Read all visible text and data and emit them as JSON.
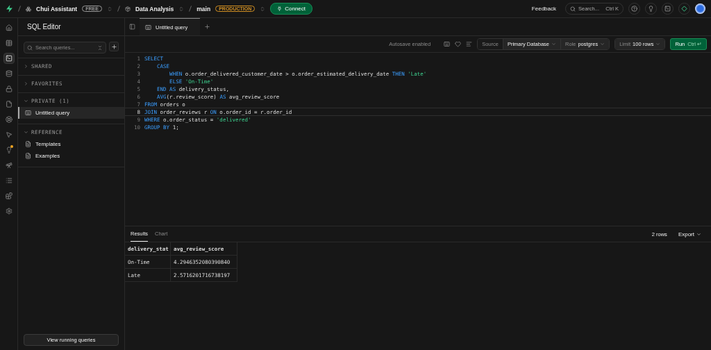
{
  "topbar": {
    "org": "Chui Assistant",
    "org_badge": "FREE",
    "project": "Data Analysis",
    "branch": "main",
    "branch_badge": "PRODUCTION",
    "connect": "Connect",
    "feedback": "Feedback",
    "search": {
      "placeholder": "Search...",
      "shortcut": "Ctrl K"
    }
  },
  "rail": [
    {
      "kind": "home",
      "selected": false
    },
    {
      "kind": "table",
      "selected": false
    },
    {
      "kind": "terminal",
      "selected": true
    },
    {
      "kind": "database",
      "selected": false
    },
    {
      "kind": "lock",
      "selected": false
    },
    {
      "kind": "file",
      "selected": false
    },
    {
      "kind": "lifebuoy",
      "selected": false
    },
    {
      "kind": "pointer",
      "selected": false
    },
    {
      "kind": "bulb",
      "selected": false
    },
    {
      "kind": "telescope",
      "selected": false
    },
    {
      "kind": "list",
      "selected": false
    },
    {
      "kind": "blocks",
      "selected": false
    },
    {
      "kind": "settings",
      "selected": false
    }
  ],
  "sidebar": {
    "title": "SQL Editor",
    "search": {
      "placeholder": "Search queries..."
    },
    "sections": [
      {
        "label": "SHARED",
        "expanded": false
      },
      {
        "label": "FAVORITES",
        "expanded": false
      },
      {
        "label": "PRIVATE (1)",
        "expanded": true,
        "items": [
          {
            "label": "Untitled query",
            "kind": "sql",
            "selected": true
          }
        ]
      },
      {
        "label": "REFERENCE",
        "expanded": true,
        "items": [
          {
            "label": "Templates",
            "kind": "doc",
            "selected": false
          },
          {
            "label": "Examples",
            "kind": "doc",
            "selected": false
          }
        ]
      }
    ],
    "footer_button": "View running queries"
  },
  "tabs": [
    {
      "label": "Untitled query",
      "selected": true
    }
  ],
  "toolbar": {
    "autosave": "Autosave enabled",
    "source_label": "Source",
    "source": "Primary Database",
    "role_label": "Role",
    "role": "postgres",
    "limit_label": "Limit",
    "limit": "100 rows",
    "run": "Run",
    "run_shortcut": "Ctrl ↵"
  },
  "code": [
    {
      "number": "1",
      "current": false,
      "tokens": [
        {
          "text": "SELECT",
          "kind": "keyword"
        }
      ]
    },
    {
      "number": "2",
      "current": false,
      "tokens": [
        {
          "text": "    CASE",
          "kind": "keyword"
        }
      ]
    },
    {
      "number": "3",
      "current": false,
      "tokens": [
        {
          "text": "        WHEN",
          "kind": "keyword"
        },
        {
          "text": " o.order_delivered_customer_date > o.order_estimated_delivery_date "
        },
        {
          "text": "THEN",
          "kind": "keyword"
        },
        {
          "text": " 'Late'",
          "kind": "string"
        }
      ]
    },
    {
      "number": "4",
      "current": false,
      "tokens": [
        {
          "text": "        ELSE",
          "kind": "keyword"
        },
        {
          "text": " 'On-Time'",
          "kind": "string"
        }
      ]
    },
    {
      "number": "5",
      "current": false,
      "tokens": [
        {
          "text": "    END AS",
          "kind": "keyword"
        },
        {
          "text": " delivery_status,"
        }
      ]
    },
    {
      "number": "6",
      "current": false,
      "tokens": [
        {
          "text": "    AVG",
          "kind": "keyword"
        },
        {
          "text": "(r.review_score) "
        },
        {
          "text": "AS",
          "kind": "keyword"
        },
        {
          "text": " avg_review_score"
        }
      ]
    },
    {
      "number": "7",
      "current": false,
      "tokens": [
        {
          "text": "FROM",
          "kind": "keyword"
        },
        {
          "text": " orders o"
        }
      ]
    },
    {
      "number": "8",
      "current": true,
      "tokens": [
        {
          "text": "JOIN",
          "kind": "keyword"
        },
        {
          "text": " order_reviews r "
        },
        {
          "text": "ON",
          "kind": "keyword"
        },
        {
          "text": " o.order_id = r.order_id"
        }
      ]
    },
    {
      "number": "9",
      "current": false,
      "tokens": [
        {
          "text": "WHERE",
          "kind": "keyword"
        },
        {
          "text": " o.order_status = "
        },
        {
          "text": "'delivered'",
          "kind": "string"
        }
      ]
    },
    {
      "number": "10",
      "current": false,
      "tokens": [
        {
          "text": "GROUP BY",
          "kind": "keyword"
        },
        {
          "text": " 1;"
        }
      ]
    }
  ],
  "results": {
    "tabs": [
      {
        "label": "Results",
        "selected": true
      },
      {
        "label": "Chart",
        "selected": false
      }
    ],
    "row_count": "2 rows",
    "export": "Export",
    "columns": [
      "delivery_stat",
      "avg_review_score"
    ],
    "rows": [
      [
        "On-Time",
        "4.2946352080390840"
      ],
      [
        "Late",
        "2.5716201716738197"
      ]
    ]
  }
}
